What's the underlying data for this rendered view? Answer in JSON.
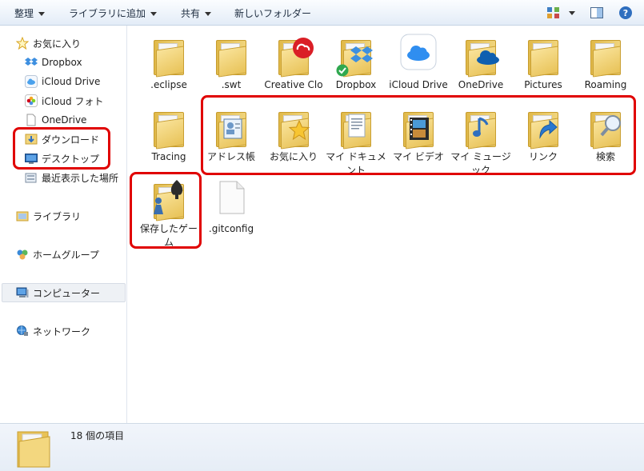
{
  "toolbar": {
    "organize": "整理",
    "library_add": "ライブラリに追加",
    "share": "共有",
    "new_folder": "新しいフォルダー",
    "view_icon": "view-options-icon",
    "preview_icon": "preview-pane-icon",
    "help_icon": "help-icon"
  },
  "sidebar": {
    "favorites": "お気に入り",
    "dropbox": "Dropbox",
    "icloud_drive": "iCloud Drive",
    "icloud_photos": "iCloud フォト",
    "onedrive": "OneDrive",
    "downloads": "ダウンロード",
    "desktop": "デスクトップ",
    "recent": "最近表示した場所",
    "libraries": "ライブラリ",
    "homegroup": "ホームグループ",
    "computer": "コンピューター",
    "network": "ネットワーク"
  },
  "items": [
    {
      "label": ".eclipse",
      "icon": "folder"
    },
    {
      "label": ".swt",
      "icon": "folder"
    },
    {
      "label": "Creative Cloud Files",
      "icon": "folder-creative-cloud"
    },
    {
      "label": "Dropbox",
      "icon": "folder-dropbox"
    },
    {
      "label": "iCloud Drive",
      "icon": "icloud-drive"
    },
    {
      "label": "OneDrive",
      "icon": "folder-onedrive"
    },
    {
      "label": "Pictures",
      "icon": "folder"
    },
    {
      "label": "Roaming",
      "icon": "folder"
    },
    {
      "label": "Tracing",
      "icon": "folder"
    },
    {
      "label": "アドレス帳",
      "icon": "folder-contacts"
    },
    {
      "label": "お気に入り",
      "icon": "folder-favorites"
    },
    {
      "label": "マイ ドキュメント",
      "icon": "folder-documents"
    },
    {
      "label": "マイ ビデオ",
      "icon": "folder-videos"
    },
    {
      "label": "マイ ミュージック",
      "icon": "folder-music"
    },
    {
      "label": "リンク",
      "icon": "folder-links"
    },
    {
      "label": "検索",
      "icon": "folder-searches"
    },
    {
      "label": "保存したゲーム",
      "icon": "folder-saved-games"
    },
    {
      "label": ".gitconfig",
      "icon": "file"
    }
  ],
  "status": {
    "count": "18 個の項目"
  },
  "colors": {
    "highlight": "#e00000",
    "folder": "#f1d57d",
    "toolbar_bg": "#e3ecf7"
  }
}
